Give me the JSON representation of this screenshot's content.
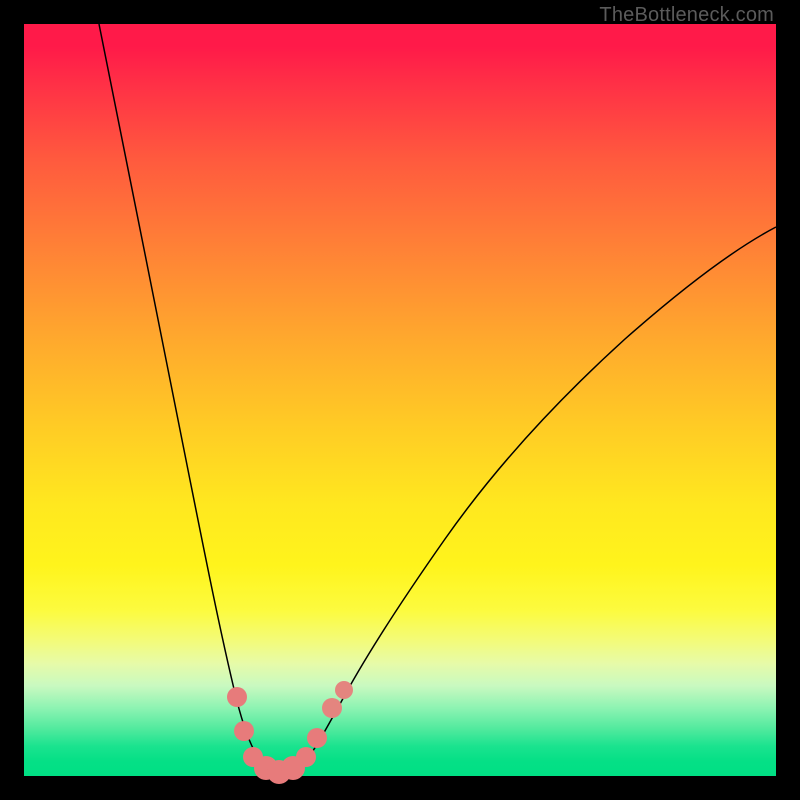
{
  "watermark": "TheBottleneck.com",
  "chart_data": {
    "type": "line",
    "title": "",
    "xlabel": "",
    "ylabel": "",
    "x_range": [
      0,
      100
    ],
    "y_range": [
      0,
      100
    ],
    "series": [
      {
        "name": "bottleneck-curve",
        "points": [
          {
            "x": 10.0,
            "y": 100.0
          },
          {
            "x": 12.0,
            "y": 90.0
          },
          {
            "x": 14.0,
            "y": 80.0
          },
          {
            "x": 16.0,
            "y": 70.0
          },
          {
            "x": 18.0,
            "y": 60.0
          },
          {
            "x": 20.0,
            "y": 50.0
          },
          {
            "x": 22.0,
            "y": 40.0
          },
          {
            "x": 24.0,
            "y": 30.0
          },
          {
            "x": 25.5,
            "y": 22.0
          },
          {
            "x": 27.0,
            "y": 15.0
          },
          {
            "x": 28.2,
            "y": 10.0
          },
          {
            "x": 29.0,
            "y": 7.0
          },
          {
            "x": 30.0,
            "y": 4.0
          },
          {
            "x": 31.0,
            "y": 2.0
          },
          {
            "x": 32.5,
            "y": 0.8
          },
          {
            "x": 34.0,
            "y": 0.5
          },
          {
            "x": 36.0,
            "y": 0.8
          },
          {
            "x": 37.5,
            "y": 2.0
          },
          {
            "x": 39.0,
            "y": 4.0
          },
          {
            "x": 40.5,
            "y": 7.0
          },
          {
            "x": 42.0,
            "y": 10.0
          },
          {
            "x": 45.0,
            "y": 15.0
          },
          {
            "x": 50.0,
            "y": 23.0
          },
          {
            "x": 56.0,
            "y": 32.0
          },
          {
            "x": 63.0,
            "y": 41.0
          },
          {
            "x": 71.0,
            "y": 50.0
          },
          {
            "x": 80.0,
            "y": 58.5
          },
          {
            "x": 90.0,
            "y": 66.5
          },
          {
            "x": 100.0,
            "y": 73.0
          }
        ]
      }
    ],
    "markers": [
      {
        "x": 28.3,
        "y": 10.5,
        "r": 10
      },
      {
        "x": 29.3,
        "y": 6.0,
        "r": 10
      },
      {
        "x": 30.5,
        "y": 2.5,
        "r": 10
      },
      {
        "x": 32.2,
        "y": 1.0,
        "r": 12
      },
      {
        "x": 34.0,
        "y": 0.6,
        "r": 12
      },
      {
        "x": 35.8,
        "y": 1.0,
        "r": 12
      },
      {
        "x": 37.5,
        "y": 2.5,
        "r": 10
      },
      {
        "x": 39.0,
        "y": 5.0,
        "r": 10
      },
      {
        "x": 41.0,
        "y": 9.0,
        "r": 10
      },
      {
        "x": 42.5,
        "y": 11.5,
        "r": 9
      }
    ],
    "background_gradient": {
      "top": "#ff1a49",
      "middle": "#ffe81f",
      "bottom": "#00df84"
    }
  }
}
